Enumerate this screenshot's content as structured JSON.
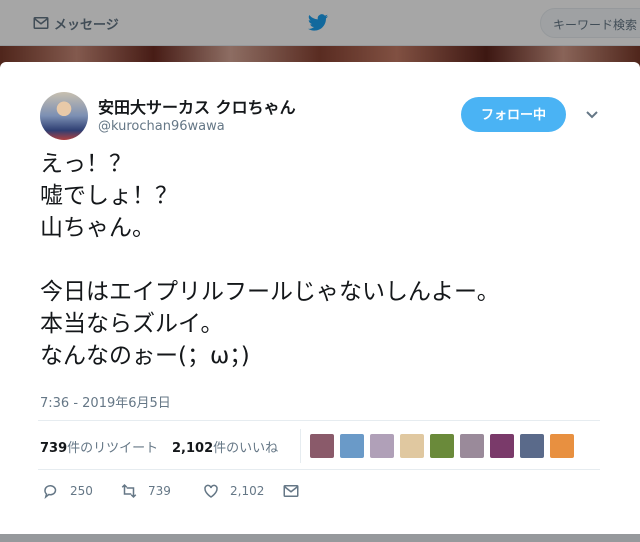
{
  "nav": {
    "messages_label": "メッセージ",
    "search_placeholder": "キーワード検索"
  },
  "tweet": {
    "display_name": "安田大サーカス クロちゃん",
    "handle": "@kurochan96wawa",
    "follow_label": "フォロー中",
    "lines": [
      "えっ！？",
      "嘘でしょ！？",
      "山ちゃん。",
      "",
      "今日はエイプリルフールじゃないしんよー。",
      "本当ならズルイ。",
      "なんなのぉー(；ω；)"
    ],
    "timestamp": "7:36 - 2019年6月5日",
    "retweets": {
      "count": "739",
      "label": "件のリツイート"
    },
    "likes": {
      "count": "2,102",
      "label": "件のいいね"
    },
    "actions": {
      "reply_count": "250",
      "retweet_count": "739",
      "like_count": "2,102"
    }
  },
  "colors": {
    "accent": "#4ab3f4",
    "brand": "#1da1f2",
    "muted": "#657786"
  },
  "liker_avatars": [
    "#8a5a6a",
    "#6a9ac8",
    "#b0a0b8",
    "#e0c8a0",
    "#6a8a3a",
    "#9a8a9a",
    "#7a3a6a",
    "#5a6a8a",
    "#e89040"
  ]
}
